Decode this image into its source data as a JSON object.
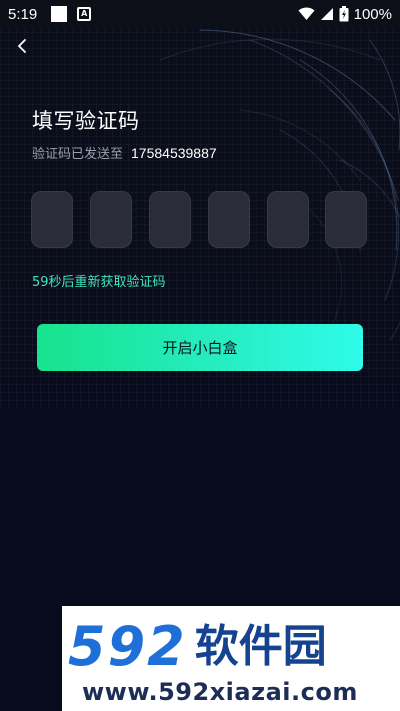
{
  "status_bar": {
    "time": "5:19",
    "battery": "100%",
    "icons": [
      "notification-square-icon",
      "a-badge-icon",
      "wifi-icon",
      "signal-icon",
      "battery-icon"
    ]
  },
  "nav": {
    "back_icon": "chevron-left-icon"
  },
  "verify": {
    "title": "填写验证码",
    "sent_label": "验证码已发送至",
    "phone": "17584539887",
    "code_slots": [
      "",
      "",
      "",
      "",
      "",
      ""
    ],
    "resend": "59秒后重新获取验证码",
    "submit": "开启小白盒"
  },
  "watermark": {
    "digits": "592",
    "name": "软件园",
    "url": "www.592xiazai.com"
  },
  "colors": {
    "background": "#080b1d",
    "accent": "#3fe6c1",
    "button_gradient_start": "#17e38c",
    "button_gradient_end": "#2ffbe9",
    "code_box": "#2a2c38",
    "watermark_blue": "#1f6fd8"
  }
}
